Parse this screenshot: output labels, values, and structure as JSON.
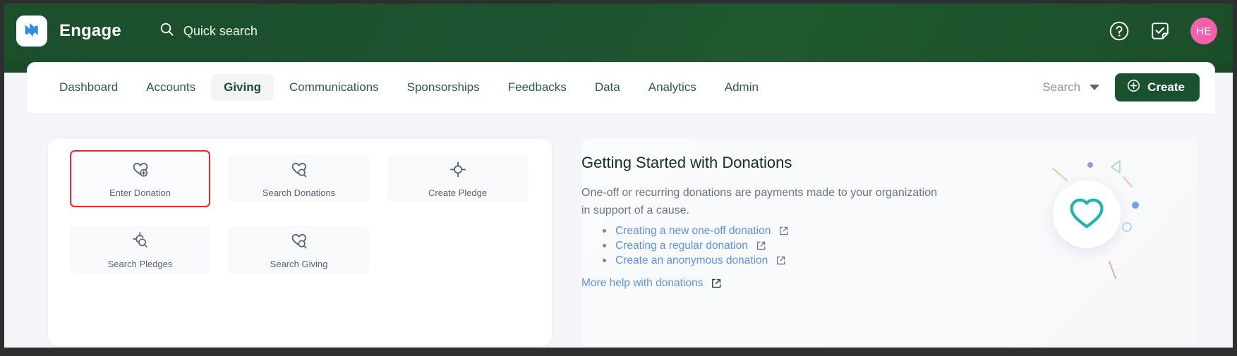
{
  "header": {
    "logo_icon": "engage-logo-icon",
    "app_title": "Engage",
    "quick_search": {
      "icon": "search-icon",
      "label": "Quick search"
    },
    "help_icon": "help-circle-icon",
    "tasks_icon": "task-checkbox-icon",
    "avatar_initials": "HE",
    "avatar_color": "#f261ab",
    "background_color": "#1d5230"
  },
  "nav": {
    "tabs": [
      {
        "label": "Dashboard",
        "active": false
      },
      {
        "label": "Accounts",
        "active": false
      },
      {
        "label": "Giving",
        "active": true
      },
      {
        "label": "Communications",
        "active": false
      },
      {
        "label": "Sponsorships",
        "active": false
      },
      {
        "label": "Feedbacks",
        "active": false
      },
      {
        "label": "Data",
        "active": false
      },
      {
        "label": "Analytics",
        "active": false
      },
      {
        "label": "Admin",
        "active": false
      }
    ],
    "search_dropdown": {
      "label": "Search",
      "icon": "chevron-down-icon"
    },
    "create_button": {
      "label": "Create",
      "icon": "plus-circle-icon",
      "color": "#1a5230"
    }
  },
  "quick_actions": {
    "tiles": [
      {
        "label": "Enter Donation",
        "icon": "heart-plus-icon",
        "highlighted": true
      },
      {
        "label": "Search Donations",
        "icon": "heart-search-icon",
        "highlighted": false
      },
      {
        "label": "Create Pledge",
        "icon": "target-plus-icon",
        "highlighted": false
      },
      {
        "label": "Search Pledges",
        "icon": "target-search-icon",
        "highlighted": false
      },
      {
        "label": "Search Giving",
        "icon": "heart-search-icon",
        "highlighted": false
      }
    ],
    "highlight_color": "#f1242c"
  },
  "getting_started": {
    "title": "Getting Started with Donations",
    "description": "One-off or recurring donations are payments made to your organization in support of a cause.",
    "links": [
      {
        "label": "Creating a new one-off donation",
        "icon": "external-link-icon"
      },
      {
        "label": "Creating a regular donation",
        "icon": "external-link-icon"
      },
      {
        "label": "Create an anonymous donation",
        "icon": "external-link-icon"
      }
    ],
    "more_help": {
      "label": "More help with donations",
      "icon": "external-link-icon"
    },
    "illustration_icon": "heart-outline-icon",
    "illustration_color": "#1fb5a8"
  }
}
